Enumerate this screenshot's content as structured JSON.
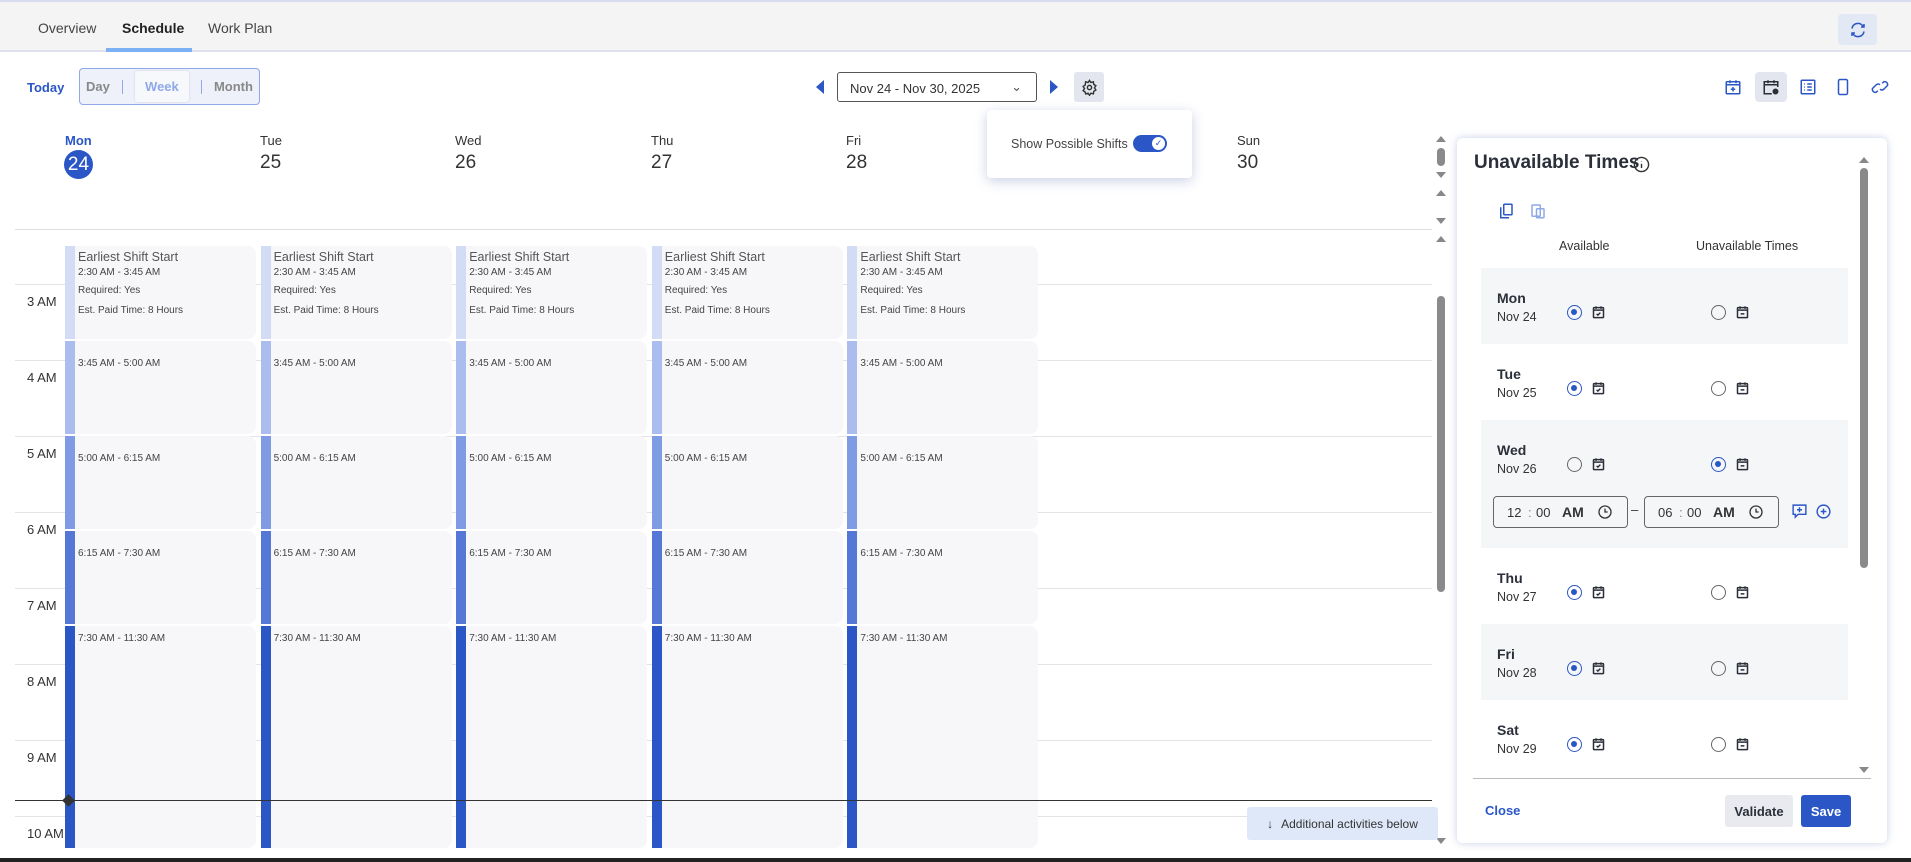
{
  "tabs": [
    {
      "label": "Overview",
      "active": false
    },
    {
      "label": "Schedule",
      "active": true
    },
    {
      "label": "Work Plan",
      "active": false
    }
  ],
  "toolbar": {
    "today": "Today",
    "views": [
      "Day",
      "Week",
      "Month"
    ],
    "selected_view": "Week",
    "date_range": "Nov 24 - Nov 30, 2025"
  },
  "popup": {
    "show_possible_shifts": "Show Possible Shifts",
    "toggle_on": true
  },
  "days": [
    {
      "name": "Mon",
      "num": "24",
      "today": true
    },
    {
      "name": "Tue",
      "num": "25"
    },
    {
      "name": "Wed",
      "num": "26"
    },
    {
      "name": "Thu",
      "num": "27"
    },
    {
      "name": "Fri",
      "num": "28"
    },
    {
      "name": "Sun",
      "num": "30"
    }
  ],
  "hours": [
    "3 AM",
    "4 AM",
    "5 AM",
    "6 AM",
    "7 AM",
    "8 AM",
    "9 AM",
    "10 AM"
  ],
  "event_days": 5,
  "events": [
    {
      "title": "Earliest Shift Start",
      "time": "2:30 AM - 3:45 AM",
      "lines": [
        "Required: Yes",
        "Est. Paid Time: 8 Hours"
      ],
      "start": "2:30",
      "end": "3:45",
      "color": "#d3dcf5"
    },
    {
      "time": "3:45 AM - 5:00 AM",
      "start": "3:45",
      "end": "5:00",
      "color": "#abbcef"
    },
    {
      "time": "5:00 AM - 6:15 AM",
      "start": "5:00",
      "end": "6:15",
      "color": "#7f9be4"
    },
    {
      "time": "6:15 AM - 7:30 AM",
      "start": "6:15",
      "end": "7:30",
      "color": "#5577d6"
    },
    {
      "time": "7:30 AM - 11:30 AM",
      "start": "7:30",
      "end": "11:30",
      "color": "#2a56c6"
    }
  ],
  "current_time": "9:47",
  "additional": "Additional activities below",
  "panel": {
    "title": "Unavailable Times",
    "col_available": "Available",
    "col_unavailable": "Unavailable Times",
    "rows": [
      {
        "day": "Mon",
        "date": "Nov 24",
        "available": true
      },
      {
        "day": "Tue",
        "date": "Nov 25",
        "available": true
      },
      {
        "day": "Wed",
        "date": "Nov 26",
        "available": false,
        "from": {
          "h": "12",
          "m": "00",
          "ap": "AM"
        },
        "to": {
          "h": "06",
          "m": "00",
          "ap": "AM"
        }
      },
      {
        "day": "Thu",
        "date": "Nov 27",
        "available": true
      },
      {
        "day": "Fri",
        "date": "Nov 28",
        "available": true
      },
      {
        "day": "Sat",
        "date": "Nov 29",
        "available": true
      }
    ],
    "close": "Close",
    "validate": "Validate",
    "save": "Save"
  },
  "colors": {
    "accent": "#2a56c6"
  }
}
